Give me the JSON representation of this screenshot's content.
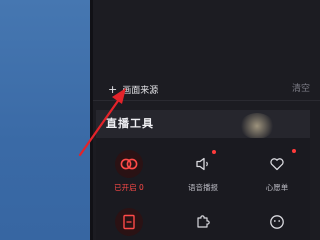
{
  "source_section": {
    "add_label": "画面来源",
    "plus_icon": "+",
    "clear_label": "清空"
  },
  "tools": {
    "title": "直播工具",
    "items": [
      {
        "label": "已开启 0",
        "icon": "dual-circle-icon",
        "active": true
      },
      {
        "label": "语音播报",
        "icon": "speaker-icon",
        "badge": true
      },
      {
        "label": "心愿单",
        "icon": "heart-icon",
        "badge": true
      },
      {
        "label": "",
        "icon": "document-icon",
        "active": true
      },
      {
        "label": "",
        "icon": "puzzle-icon"
      },
      {
        "label": "",
        "icon": "smile-icon"
      }
    ]
  },
  "colors": {
    "desktop_blue": "#3d6da8",
    "panel_bg": "#1c1c22",
    "accent_red": "#ff4a48",
    "annotation_arrow": "#e3232a"
  }
}
